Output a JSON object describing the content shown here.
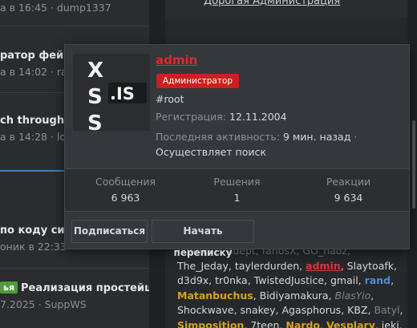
{
  "threads": [
    {
      "meta": "а в 16:45 · dump1337"
    },
    {
      "title": "ратор фейко",
      "meta": "а в 14:02 · ra"
    },
    {
      "title": "ch through m",
      "meta": "а в 14:28 · lo"
    },
    {
      "title": "по коду си++",
      "meta": "оник в 22:33 ·"
    },
    {
      "tag": "ья",
      "title": "Реализация простейше...",
      "meta": "7.2025 · SuppWS"
    }
  ],
  "sidebar_top_link": "Дорогая Администрация",
  "online_users": {
    "line1": "nipeople, adept, fanosX, GO_haoz,",
    "row2_a": "The_Jeday, taylerdurden, ",
    "row2_admin": "admin",
    "row2_b": ", Slaytoafk,",
    "row3_a": "d3d9x, tr0nka, TwistedJustice, gmail, ",
    "row3_rand": "rand",
    "row3_b": ",",
    "row4_matan": "Matanbuchus",
    "row4_a": ", Bidiyamakura, ",
    "row4_blas": "BlasYio",
    "row4_b": ",",
    "row5_a": "Shockwave, snakey, Agasphorus, KBZ, ",
    "row5_batyl": "Batyl",
    "row5_b": ",",
    "row6_simp": "Simposition",
    "row6_a": ", 7teen, ",
    "row6_nardo": "Nardo",
    "row6_b": ", ",
    "row6_vesp": "Vesplary",
    "row6_c": ", jeki,"
  },
  "member_card": {
    "avatar_text_top": "XSS",
    "avatar_text_domain": ".IS",
    "username": "admin",
    "role": "Администратор",
    "user_title": "#root",
    "registration_label": "Регистрация:",
    "registration_value": "12.11.2004",
    "activity_label": "Последняя активность:",
    "activity_value": "9 мин. назад",
    "activity_sep": "·",
    "activity_status": "Осуществляет поиск",
    "stats": [
      {
        "label": "Сообщения",
        "value": "6 963"
      },
      {
        "label": "Решения",
        "value": "1"
      },
      {
        "label": "Реакции",
        "value": "9 634"
      }
    ],
    "follow_button": "Подписаться",
    "message_button": "Начать переписку"
  },
  "colors": {
    "admin_red": "#e02828",
    "role_badge": "#cc1f1f",
    "accent_blue": "#3a7fc4",
    "gold": "#d4a21c"
  },
  "icons": [
    "xss-logo-icon"
  ]
}
